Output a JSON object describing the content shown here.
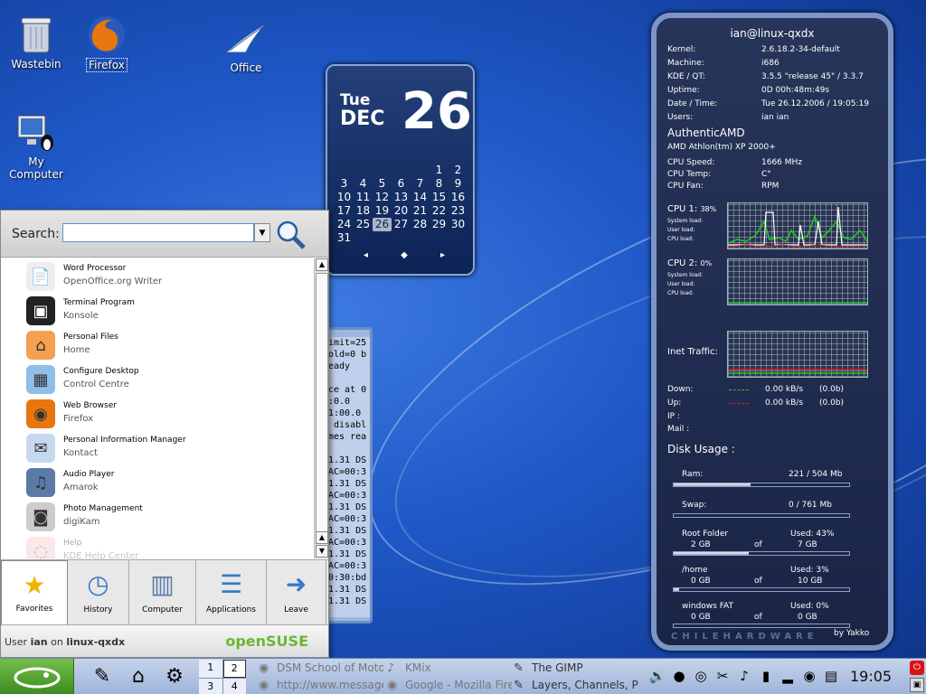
{
  "desktop": {
    "icons": [
      {
        "label": "Wastebin",
        "icon": "trash-icon"
      },
      {
        "label": "Firefox",
        "icon": "firefox-icon"
      },
      {
        "label": "Office",
        "icon": "office-icon"
      },
      {
        "label": "My Computer",
        "icon": "computer-icon"
      }
    ]
  },
  "calendar": {
    "day": "Tue",
    "month": "DEC",
    "date": "26",
    "days": [
      "1",
      "2",
      "3",
      "4",
      "5",
      "6",
      "7",
      "8",
      "9",
      "10",
      "11",
      "12",
      "13",
      "14",
      "15",
      "16",
      "17",
      "18",
      "19",
      "20",
      "21",
      "22",
      "23",
      "24",
      "25",
      "26",
      "27",
      "28",
      "29",
      "30",
      "31"
    ],
    "today": "26",
    "nav": [
      "◂",
      "◆",
      "▸"
    ]
  },
  "terminal_fragment": {
    "lines": [
      "imit=25",
      "old=0 b",
      "eady",
      "",
      "ce at 0",
      ":0.0",
      "1:00.0",
      " disabl",
      "mes rea",
      "",
      "1.31 DS",
      "AC=00:3",
      "1.31 DS",
      "AC=00:3",
      "1.31 DS",
      "AC=00:3",
      "1.31 DS",
      "AC=00:3",
      "1.31 DS",
      "AC=00:3",
      "0:30:bd",
      "1.31 DS",
      "1.31 DS"
    ]
  },
  "sysmon": {
    "title": "ian@linux-qxdx",
    "info": [
      {
        "k": "Kernel:",
        "v": "2.6.18.2-34-default"
      },
      {
        "k": "Machine:",
        "v": "i686"
      },
      {
        "k": "KDE / QT:",
        "v": "3.5.5 \"release 45\" / 3.3.7"
      },
      {
        "k": "Uptime:",
        "v": "0D   00h:48m:49s"
      },
      {
        "k": "Date / Time:",
        "v": "Tue 26.12.2006  /  19:05:19"
      },
      {
        "k": "Users:",
        "v": "ian ian"
      }
    ],
    "cpu_vendor": "AuthenticAMD",
    "cpu_model": "AMD Athlon(tm) XP 2000+",
    "cpu_info": [
      {
        "k": "CPU Speed:",
        "v": "1666 MHz"
      },
      {
        "k": "CPU Temp:",
        "v": "C°"
      },
      {
        "k": "CPU Fan:",
        "v": "RPM"
      }
    ],
    "cpu1_label": "CPU 1:",
    "cpu1_pct": "38%",
    "cpu2_label": "CPU 2:",
    "cpu2_pct": "0%",
    "load_labels": [
      "System load:",
      "User load:",
      "CPU load:"
    ],
    "inet_label": "Inet Traffic:",
    "net": [
      {
        "k": "Down:",
        "rate": "0.00 kB/s",
        "tot": "(0.0b)"
      },
      {
        "k": "Up:",
        "rate": "0.00 kB/s",
        "tot": "(0.0b)"
      }
    ],
    "ip_label": "IP :",
    "mail_label": "Mail :",
    "disk_title": "Disk Usage :",
    "ram": {
      "k": "Ram:",
      "v": "221 / 504 Mb",
      "fill": 0.44
    },
    "swap": {
      "k": "Swap:",
      "v": "0 / 761 Mb",
      "fill": 0
    },
    "disks": [
      {
        "name": "Root Folder",
        "used": "Used: 43%",
        "a": "2 GB",
        "of": "of",
        "b": "7 GB",
        "fill": 0.43
      },
      {
        "name": "/home",
        "used": "Used: 3%",
        "a": "0 GB",
        "of": "of",
        "b": "10 GB",
        "fill": 0.03
      },
      {
        "name": "windows FAT",
        "used": "Used: 0%",
        "a": "0 GB",
        "of": "of",
        "b": "0 GB",
        "fill": 0
      }
    ],
    "credit": "by Yakko",
    "watermark": "CHILEHARDWARE"
  },
  "kmenu": {
    "search_label": "Search:",
    "search_value": "",
    "items": [
      {
        "title": "Word Processor",
        "sub": "OpenOffice.org Writer",
        "icon": "document-icon"
      },
      {
        "title": "Terminal Program",
        "sub": "Konsole",
        "icon": "terminal-icon"
      },
      {
        "title": "Personal Files",
        "sub": "Home",
        "icon": "home-icon"
      },
      {
        "title": "Configure Desktop",
        "sub": "Control Centre",
        "icon": "control-centre-icon"
      },
      {
        "title": "Web Browser",
        "sub": "Firefox",
        "icon": "firefox-icon"
      },
      {
        "title": "Personal Information Manager",
        "sub": "Kontact",
        "icon": "kontact-icon"
      },
      {
        "title": "Audio Player",
        "sub": "Amarok",
        "icon": "amarok-icon"
      },
      {
        "title": "Photo Management",
        "sub": "digiKam",
        "icon": "camera-icon"
      },
      {
        "title": "Help",
        "sub": "KDE Help Center",
        "icon": "help-icon"
      }
    ],
    "tabs": [
      {
        "label": "Favorites",
        "icon": "star-icon"
      },
      {
        "label": "History",
        "icon": "clock-icon"
      },
      {
        "label": "Computer",
        "icon": "computer-icon"
      },
      {
        "label": "Applications",
        "icon": "list-icon"
      },
      {
        "label": "Leave",
        "icon": "leave-icon"
      }
    ],
    "user_prefix": "User ",
    "user": "ian",
    "on": " on ",
    "host": "linux-qxdx",
    "brand": "openSUSE"
  },
  "panel": {
    "pager": [
      "1",
      "2",
      "3",
      "4"
    ],
    "tasks": [
      {
        "label": "DSM School of Motor",
        "dim": true
      },
      {
        "label": "http://www.message",
        "dim": true
      },
      {
        "label": "KMix",
        "dim": true
      },
      {
        "label": "Google - Mozilla Fire",
        "dim": true
      },
      {
        "label": "The GIMP",
        "dim": false
      },
      {
        "label": "Layers, Channels, Pa",
        "dim": false
      }
    ],
    "clock": "19:05"
  }
}
